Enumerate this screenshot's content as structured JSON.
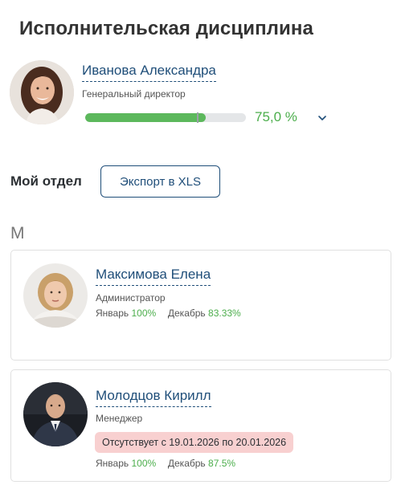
{
  "page": {
    "title": "Исполнительская дисциплина"
  },
  "head": {
    "name": "Иванова Александра",
    "role": "Генеральный директор",
    "progress_fraction": 0.75,
    "percent_label": "75,0 %",
    "avatar_icon": "photo-woman-brunette"
  },
  "department": {
    "label": "Мой отдел",
    "export_label": "Экспорт в XLS"
  },
  "group": {
    "letter": "М"
  },
  "employees": [
    {
      "name": "Максимова Елена",
      "role": "Администратор",
      "stat1_label": "Январь",
      "stat1_value": "100%",
      "stat2_label": "Декабрь",
      "stat2_value": "83.33%",
      "avatar_icon": "photo-woman-blonde"
    },
    {
      "name": "Молодцов Кирилл",
      "role": "Менеджер",
      "absence": "Отсутствует с 19.01.2026 по 20.01.2026",
      "stat1_label": "Январь",
      "stat1_value": "100%",
      "stat2_label": "Декабрь",
      "stat2_value": "87.5%",
      "avatar_icon": "photo-man-suit"
    }
  ],
  "colors": {
    "accent": "#1f4e79",
    "success": "#5cb85c",
    "absence_bg": "#f8d0d0"
  }
}
